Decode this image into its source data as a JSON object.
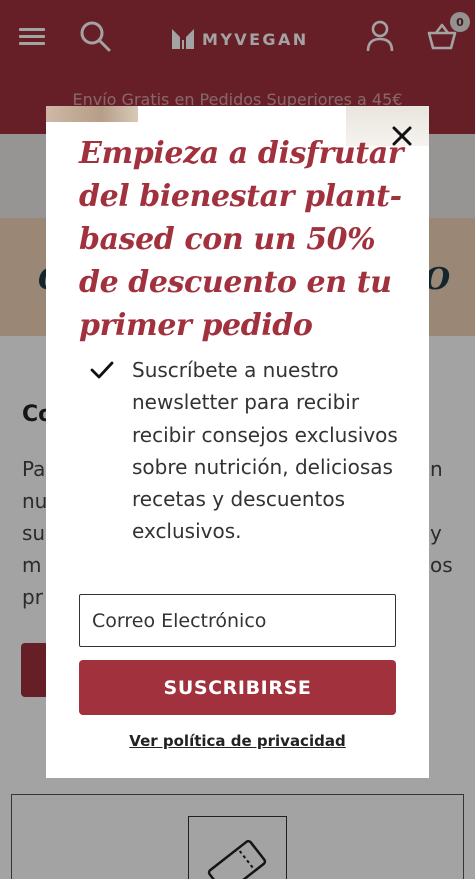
{
  "header": {
    "brand": "MYVEGAN",
    "basket_count": "0",
    "shipping_banner": "Envío Gratis en Pedidos Superiores a 45€"
  },
  "background": {
    "peach_left": "C",
    "peach_right": "O",
    "heading": "Co",
    "lines": [
      {
        "left": "Pa",
        "right": "n"
      },
      {
        "left": "nu",
        "right": ""
      },
      {
        "left": "su",
        "right": "y"
      },
      {
        "left": "m",
        "right": "os"
      },
      {
        "left": "pr",
        "right": ""
      }
    ]
  },
  "modal": {
    "title": "Empieza a disfrutar del bienestar plant-based con un 50% de descuento en tu primer pedido",
    "bullet": "Suscríbete a nuestro newsletter para recibir recibir consejos exclusivos sobre nutrición, deliciosas recetas y descuentos exclusivos.",
    "email_placeholder": "Correo Electrónico",
    "subscribe_label": "SUSCRIBIRSE",
    "privacy_link": "Ver política de privacidad"
  },
  "colors": {
    "brand": "#a2313e",
    "peach": "#f2d4b7",
    "band_grey": "#ebe9e6",
    "navy_text": "#1e3a47"
  },
  "icons": [
    "menu-icon",
    "search-icon",
    "myvegan-logo-icon",
    "account-icon",
    "basket-icon",
    "close-icon",
    "check-icon",
    "coupon-icon"
  ]
}
